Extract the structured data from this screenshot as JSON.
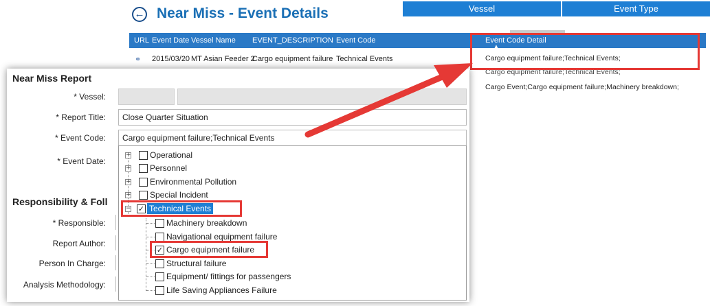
{
  "event_details": {
    "title": "Near Miss - Event Details",
    "back_icon": "back-arrow-icon",
    "tabs": [
      "Vessel",
      "Event Type"
    ],
    "columns": [
      "URL",
      "Event Date",
      "Vessel Name",
      "EVENT_DESCRIPTION",
      "Event Code",
      "Event Code Detail"
    ],
    "row": {
      "link_icon": "link-icon",
      "event_date": "2015/03/20",
      "vessel_name": "MT Asian Feeder 2",
      "description": "Cargo equipment failure",
      "event_code": "Technical Events"
    },
    "code_details": [
      "Cargo equipment failure;Technical Events;",
      "Cargo equipment failure;Technical Events;",
      "Cargo Event;Cargo equipment failure;Machinery breakdown;"
    ]
  },
  "report": {
    "title": "Near Miss Report",
    "labels": {
      "vessel": "* Vessel:",
      "report_title": "* Report Title:",
      "event_code": "* Event Code:",
      "event_date": "* Event Date:",
      "responsible": "* Responsible:",
      "report_author": "Report Author:",
      "person_in_charge": "Person In Charge:",
      "analysis_methodology": "Analysis Methodology:"
    },
    "report_title_value": "Close Quarter Situation",
    "event_code_value": "Cargo equipment failure;Technical Events",
    "section_title": "Responsibility & Foll"
  },
  "tree": {
    "top_nodes": [
      "Operational",
      "Personnel",
      "Environmental Pollution",
      "Special Incident"
    ],
    "technical": "Technical Events",
    "children": [
      "Machinery breakdown",
      "Navigational equipment failure",
      "Cargo equipment failure",
      "Structural failure",
      "Equipment/ fittings for passengers",
      "Life Saving Appliances Failure"
    ],
    "expand_glyph": "+",
    "collapse_glyph": "−",
    "check_glyph": "✓"
  },
  "colors": {
    "accent": "#1e7fd4",
    "highlight": "#e53935"
  }
}
